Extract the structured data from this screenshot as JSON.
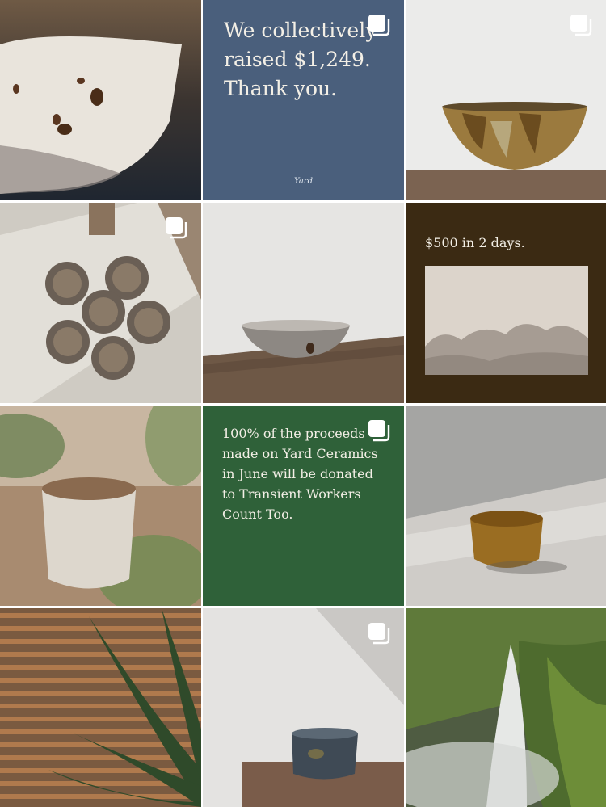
{
  "feed": {
    "tiles": [
      {
        "id": "t00",
        "kind": "photo",
        "icon": "none",
        "subject": "white crackle glaze bowl close-up"
      },
      {
        "id": "t01",
        "kind": "text-card",
        "icon": "multiple-posts-icon",
        "bg_color": "#4a5f7c",
        "text": "We collectively raised $1,249. Thank you.",
        "signature": "Yard"
      },
      {
        "id": "t02",
        "kind": "photo",
        "icon": "multiple-posts-icon",
        "subject": "brown glaze bowl on wood"
      },
      {
        "id": "t10",
        "kind": "photo",
        "icon": "multiple-posts-icon",
        "subject": "six small cups on linen"
      },
      {
        "id": "t11",
        "kind": "photo",
        "icon": "none",
        "subject": "speckled bowl on wood plank"
      },
      {
        "id": "t12",
        "kind": "text-card",
        "icon": "none",
        "bg_color": "#3b2a13",
        "text": "$500 in 2 days."
      },
      {
        "id": "t20",
        "kind": "photo",
        "icon": "none",
        "subject": "speckled white cup with leaves"
      },
      {
        "id": "t21",
        "kind": "text-card",
        "icon": "multiple-posts-icon",
        "bg_color": "#2f6139",
        "text": "100% of the proceeds made on Yard Ceramics in June will be donated to Transient Workers Count Too."
      },
      {
        "id": "t22",
        "kind": "photo",
        "icon": "none",
        "subject": "amber glaze cup in sunlight"
      },
      {
        "id": "t30",
        "kind": "photo",
        "icon": "none",
        "subject": "blinds and palm leaves"
      },
      {
        "id": "t31",
        "kind": "photo",
        "icon": "multiple-posts-icon",
        "subject": "blue glaze cup on block"
      },
      {
        "id": "t32",
        "kind": "photo",
        "icon": "none",
        "subject": "mossy cliff waterfall"
      }
    ]
  }
}
